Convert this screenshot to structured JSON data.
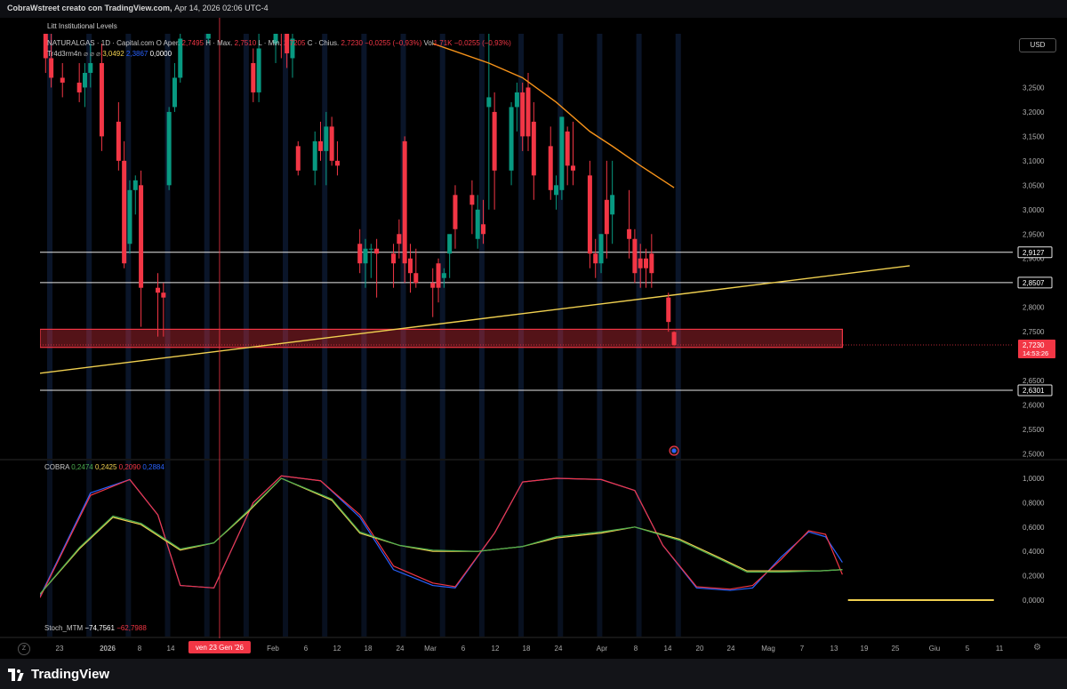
{
  "header": {
    "author": "CobraWstreet creato con TradingView.com,",
    "datetime": "Apr 14, 2026 02:06 UTC-4"
  },
  "indicator_title": "Litt Institutional Levels",
  "symbol_line": {
    "symbol": "NATURALGAS · 1D · Capital.com",
    "open_label": "O",
    "open_text": "Aper.",
    "open_value": "2,7495",
    "high_text": "H · Max.",
    "high_value": "2,7510",
    "low_text": "L · Min.",
    "low_value": "2,7205",
    "close_text": "C · Chius.",
    "close_value": "2,7230",
    "change": "−0,0255 (−0,93%)",
    "vol_label": "Vol",
    "vol_value": "1,71K"
  },
  "trader_line": {
    "name": "Tr4d3rm4n",
    "icons": "⌀ ⌀ ⌀",
    "v1": "3,0492",
    "v2": "2,3867",
    "v3": "0,0000"
  },
  "currency_button": "USD",
  "levels": [
    {
      "price": 2.9127,
      "label": "2,9127"
    },
    {
      "price": 2.8507,
      "label": "2,8507"
    },
    {
      "price": 2.6301,
      "label": "2,6301"
    }
  ],
  "last_price": {
    "label": "2,7230",
    "countdown": "14:53:26",
    "price": 2.723
  },
  "price_axis": {
    "labels": [
      "3,2500",
      "3,2000",
      "3,1500",
      "3,1000",
      "3,0500",
      "3,0000",
      "2,9500",
      "2,9000",
      "2,8000",
      "2,7500",
      "2,6500",
      "2,6000",
      "2,5500",
      "2,5000"
    ],
    "values": [
      3.25,
      3.2,
      3.15,
      3.1,
      3.05,
      3.0,
      2.95,
      2.9,
      2.8,
      2.75,
      2.65,
      2.6,
      2.55,
      2.5
    ]
  },
  "cobra": {
    "name": "COBRA",
    "values": [
      "0,2474",
      "0,2425",
      "0,2090",
      "0,2884"
    ],
    "colors": [
      "#4caf50",
      "#f0d050",
      "#f23645",
      "#2962ff"
    ],
    "axis_labels": [
      "1,0000",
      "0,8000",
      "0,6000",
      "0,4000",
      "0,2000",
      "0,0000"
    ],
    "axis_values": [
      1.0,
      0.8,
      0.6,
      0.4,
      0.2,
      0.0
    ]
  },
  "stoch": {
    "name": "Stoch_MTM",
    "v1": "−74,7561",
    "v2": "−62,7988"
  },
  "time_axis": {
    "labels": [
      "23",
      "2026",
      "8",
      "14",
      "Feb",
      "6",
      "12",
      "18",
      "24",
      "Mar",
      "6",
      "12",
      "18",
      "24",
      "Apr",
      "8",
      "14",
      "20",
      "24",
      "Mag",
      "7",
      "13",
      "19",
      "25",
      "Giu",
      "5",
      "11"
    ],
    "crosshair_label": "ven 23 Gen '26"
  },
  "colors": {
    "up": "#089981",
    "down": "#f23645",
    "ma": "#f7931a",
    "trend": "#f0d050",
    "zone": "#f23645",
    "blue_line": "#2962ff"
  },
  "chart_data": {
    "type": "candlestick",
    "title": "NATURALGAS · 1D · Capital.com",
    "ylim": [
      2.49,
      3.36
    ],
    "x_start": "2025-12-22",
    "x_end": "2026-06-14",
    "candles": [
      [
        "2025-12-23",
        3.46,
        3.58,
        3.28,
        3.31
      ],
      [
        "2025-12-24",
        3.31,
        3.36,
        3.25,
        3.27
      ],
      [
        "2025-12-26",
        3.27,
        3.3,
        3.23,
        3.26
      ],
      [
        "2025-12-29",
        3.26,
        3.3,
        3.22,
        3.24
      ],
      [
        "2025-12-30",
        3.25,
        3.3,
        3.21,
        3.28
      ],
      [
        "2025-12-31",
        3.28,
        3.34,
        3.25,
        3.3
      ],
      [
        "2026-01-02",
        3.3,
        3.34,
        3.12,
        3.15
      ],
      [
        "2026-01-05",
        3.18,
        3.22,
        3.08,
        3.1
      ],
      [
        "2026-01-06",
        3.1,
        3.14,
        2.88,
        2.89
      ],
      [
        "2026-01-07",
        2.93,
        3.06,
        2.91,
        3.04
      ],
      [
        "2026-01-08",
        3.04,
        3.07,
        2.99,
        3.06
      ],
      [
        "2026-01-09",
        3.05,
        3.08,
        2.76,
        2.84
      ],
      [
        "2026-01-12",
        2.84,
        2.87,
        2.74,
        2.83
      ],
      [
        "2026-01-13",
        2.83,
        2.85,
        2.74,
        2.82
      ],
      [
        "2026-01-14",
        3.05,
        3.21,
        3.04,
        3.2
      ],
      [
        "2026-01-15",
        3.21,
        3.3,
        3.2,
        3.27
      ],
      [
        "2026-01-16",
        3.27,
        3.36,
        3.26,
        3.35
      ],
      [
        "2026-01-21",
        3.35,
        3.6,
        3.34,
        3.55
      ],
      [
        "2026-01-26",
        3.5,
        3.75,
        3.45,
        3.6
      ],
      [
        "2026-01-29",
        3.3,
        3.33,
        3.22,
        3.24
      ],
      [
        "2026-01-30",
        3.24,
        3.36,
        3.22,
        3.33
      ],
      [
        "2026-02-02",
        3.34,
        3.4,
        3.3,
        3.38
      ],
      [
        "2026-02-03",
        3.37,
        3.4,
        3.31,
        3.36
      ],
      [
        "2026-02-04",
        3.36,
        3.4,
        3.29,
        3.32
      ],
      [
        "2026-02-05",
        3.31,
        3.36,
        3.27,
        3.35
      ],
      [
        "2026-02-06",
        3.13,
        3.14,
        3.07,
        3.08
      ],
      [
        "2026-02-09",
        3.08,
        3.16,
        3.05,
        3.14
      ],
      [
        "2026-02-10",
        3.14,
        3.18,
        3.1,
        3.12
      ],
      [
        "2026-02-11",
        3.12,
        3.2,
        3.05,
        3.17
      ],
      [
        "2026-02-12",
        3.17,
        3.19,
        3.09,
        3.1
      ],
      [
        "2026-02-13",
        3.1,
        3.14,
        3.07,
        3.09
      ],
      [
        "2026-02-17",
        2.93,
        2.96,
        2.87,
        2.89
      ],
      [
        "2026-02-18",
        2.89,
        2.94,
        2.84,
        2.92
      ],
      [
        "2026-02-19",
        2.92,
        2.93,
        2.86,
        2.92
      ],
      [
        "2026-02-20",
        2.92,
        2.94,
        2.82,
        2.91
      ],
      [
        "2026-02-23",
        2.91,
        2.93,
        2.84,
        2.89
      ],
      [
        "2026-02-24",
        2.95,
        2.98,
        2.9,
        2.93
      ],
      [
        "2026-02-25",
        3.14,
        3.15,
        2.85,
        2.89
      ],
      [
        "2026-02-26",
        2.9,
        2.93,
        2.83,
        2.87
      ],
      [
        "2026-02-27",
        2.87,
        2.92,
        2.84,
        2.85
      ],
      [
        "2026-03-02",
        2.85,
        2.88,
        2.78,
        2.84
      ],
      [
        "2026-03-03",
        2.89,
        2.9,
        2.81,
        2.84
      ],
      [
        "2026-03-04",
        2.86,
        2.88,
        2.84,
        2.87
      ],
      [
        "2026-03-05",
        2.91,
        2.94,
        2.86,
        2.95
      ],
      [
        "2026-03-06",
        3.03,
        3.05,
        2.92,
        2.96
      ],
      [
        "2026-03-09",
        3.03,
        3.06,
        2.95,
        3.01
      ],
      [
        "2026-03-10",
        2.94,
        3.03,
        2.92,
        3.0
      ],
      [
        "2026-03-11",
        2.97,
        3.02,
        2.93,
        2.95
      ],
      [
        "2026-03-12",
        3.21,
        3.4,
        3.0,
        3.23
      ],
      [
        "2026-03-13",
        3.2,
        3.24,
        3.0,
        3.08
      ],
      [
        "2026-03-16",
        3.08,
        3.22,
        3.05,
        3.21
      ],
      [
        "2026-03-17",
        3.21,
        3.26,
        3.16,
        3.24
      ],
      [
        "2026-03-18",
        3.24,
        3.26,
        3.12,
        3.15
      ],
      [
        "2026-03-19",
        3.25,
        3.28,
        3.12,
        3.15
      ],
      [
        "2026-03-20",
        3.18,
        3.22,
        3.02,
        3.07
      ],
      [
        "2026-03-23",
        3.13,
        3.17,
        3.02,
        3.04
      ],
      [
        "2026-03-24",
        3.03,
        3.07,
        3.0,
        3.05
      ],
      [
        "2026-03-25",
        3.04,
        3.19,
        3.02,
        3.19
      ],
      [
        "2026-03-26",
        3.16,
        3.17,
        3.05,
        3.09
      ],
      [
        "2026-03-27",
        3.09,
        3.18,
        3.05,
        3.08
      ],
      [
        "2026-03-30",
        3.07,
        3.1,
        2.88,
        2.91
      ],
      [
        "2026-03-31",
        2.91,
        2.94,
        2.86,
        2.89
      ],
      [
        "2026-04-01",
        2.89,
        2.95,
        2.87,
        2.95
      ],
      [
        "2026-04-02",
        3.02,
        3.1,
        2.9,
        2.95
      ],
      [
        "2026-04-03",
        2.99,
        3.1,
        2.93,
        3.03
      ],
      [
        "2026-04-06",
        2.96,
        3.04,
        2.9,
        2.94
      ],
      [
        "2026-04-07",
        2.94,
        2.96,
        2.85,
        2.87
      ],
      [
        "2026-04-08",
        2.9,
        2.93,
        2.84,
        2.88
      ],
      [
        "2026-04-09",
        2.9,
        2.92,
        2.84,
        2.88
      ],
      [
        "2026-04-10",
        2.91,
        2.95,
        2.84,
        2.87
      ],
      [
        "2026-04-13",
        2.82,
        2.83,
        2.75,
        2.77
      ],
      [
        "2026-04-14",
        2.7495,
        2.751,
        2.7205,
        2.723
      ]
    ],
    "moving_average": [
      [
        "2026-03-02",
        3.34
      ],
      [
        "2026-03-12",
        3.3
      ],
      [
        "2026-03-18",
        3.27
      ],
      [
        "2026-03-24",
        3.22
      ],
      [
        "2026-03-30",
        3.16
      ],
      [
        "2026-04-03",
        3.13
      ],
      [
        "2026-04-08",
        3.09
      ],
      [
        "2026-04-14",
        3.045
      ]
    ],
    "trendline": [
      [
        "2025-12-22",
        2.665
      ],
      [
        "2026-05-26",
        2.885
      ]
    ],
    "zone": {
      "x_start": "2025-12-22",
      "x_end": "2026-05-14",
      "y_low": 2.718,
      "y_high": 2.755
    },
    "horizontal_levels": [
      2.9127,
      2.8507,
      2.6301
    ],
    "cobra_series": [
      {
        "name": "blue",
        "color": "#2962ff",
        "points": [
          [
            "2025-12-22",
            0.03
          ],
          [
            "2025-12-31",
            0.88
          ],
          [
            "2026-01-07",
            0.99
          ],
          [
            "2026-01-12",
            0.7
          ],
          [
            "2026-01-16",
            0.12
          ],
          [
            "2026-01-22",
            0.1
          ],
          [
            "2026-01-29",
            0.8
          ],
          [
            "2026-02-03",
            1.02
          ],
          [
            "2026-02-10",
            0.98
          ],
          [
            "2026-02-17",
            0.68
          ],
          [
            "2026-02-23",
            0.25
          ],
          [
            "2026-03-02",
            0.12
          ],
          [
            "2026-03-06",
            0.1
          ],
          [
            "2026-03-13",
            0.55
          ],
          [
            "2026-03-18",
            0.97
          ],
          [
            "2026-03-24",
            1.0
          ],
          [
            "2026-04-01",
            0.99
          ],
          [
            "2026-04-07",
            0.9
          ],
          [
            "2026-04-12",
            0.45
          ],
          [
            "2026-04-18",
            0.1
          ],
          [
            "2026-04-24",
            0.08
          ],
          [
            "2026-04-28",
            0.1
          ],
          [
            "2026-05-03",
            0.35
          ],
          [
            "2026-05-08",
            0.56
          ],
          [
            "2026-05-11",
            0.52
          ],
          [
            "2026-05-14",
            0.31
          ]
        ]
      },
      {
        "name": "red",
        "color": "#f23645",
        "points": [
          [
            "2025-12-22",
            0.02
          ],
          [
            "2025-12-31",
            0.86
          ],
          [
            "2026-01-07",
            0.99
          ],
          [
            "2026-01-12",
            0.7
          ],
          [
            "2026-01-16",
            0.12
          ],
          [
            "2026-01-22",
            0.1
          ],
          [
            "2026-01-29",
            0.8
          ],
          [
            "2026-02-03",
            1.02
          ],
          [
            "2026-02-10",
            0.98
          ],
          [
            "2026-02-17",
            0.7
          ],
          [
            "2026-02-23",
            0.28
          ],
          [
            "2026-03-02",
            0.14
          ],
          [
            "2026-03-06",
            0.11
          ],
          [
            "2026-03-13",
            0.55
          ],
          [
            "2026-03-18",
            0.97
          ],
          [
            "2026-03-24",
            1.0
          ],
          [
            "2026-04-01",
            0.99
          ],
          [
            "2026-04-07",
            0.9
          ],
          [
            "2026-04-12",
            0.45
          ],
          [
            "2026-04-18",
            0.11
          ],
          [
            "2026-04-24",
            0.09
          ],
          [
            "2026-04-28",
            0.12
          ],
          [
            "2026-05-03",
            0.33
          ],
          [
            "2026-05-08",
            0.57
          ],
          [
            "2026-05-11",
            0.54
          ],
          [
            "2026-05-14",
            0.21
          ]
        ]
      },
      {
        "name": "yellow",
        "color": "#f0d050",
        "points": [
          [
            "2025-12-22",
            0.05
          ],
          [
            "2025-12-29",
            0.42
          ],
          [
            "2026-01-04",
            0.68
          ],
          [
            "2026-01-09",
            0.62
          ],
          [
            "2026-01-16",
            0.41
          ],
          [
            "2026-01-22",
            0.47
          ],
          [
            "2026-01-28",
            0.72
          ],
          [
            "2026-02-03",
            1.0
          ],
          [
            "2026-02-12",
            0.82
          ],
          [
            "2026-02-17",
            0.55
          ],
          [
            "2026-02-24",
            0.45
          ],
          [
            "2026-03-02",
            0.4
          ],
          [
            "2026-03-10",
            0.4
          ],
          [
            "2026-03-18",
            0.44
          ],
          [
            "2026-03-24",
            0.51
          ],
          [
            "2026-04-01",
            0.55
          ],
          [
            "2026-04-07",
            0.6
          ],
          [
            "2026-04-15",
            0.5
          ],
          [
            "2026-04-22",
            0.35
          ],
          [
            "2026-04-27",
            0.24
          ],
          [
            "2026-05-03",
            0.24
          ],
          [
            "2026-05-10",
            0.24
          ],
          [
            "2026-05-14",
            0.25
          ]
        ]
      },
      {
        "name": "green",
        "color": "#4caf50",
        "points": [
          [
            "2025-12-22",
            0.05
          ],
          [
            "2025-12-29",
            0.43
          ],
          [
            "2026-01-04",
            0.69
          ],
          [
            "2026-01-09",
            0.63
          ],
          [
            "2026-01-16",
            0.42
          ],
          [
            "2026-01-22",
            0.47
          ],
          [
            "2026-01-28",
            0.73
          ],
          [
            "2026-02-03",
            1.0
          ],
          [
            "2026-02-12",
            0.83
          ],
          [
            "2026-02-17",
            0.56
          ],
          [
            "2026-02-24",
            0.45
          ],
          [
            "2026-03-02",
            0.41
          ],
          [
            "2026-03-10",
            0.4
          ],
          [
            "2026-03-18",
            0.44
          ],
          [
            "2026-03-24",
            0.52
          ],
          [
            "2026-04-01",
            0.56
          ],
          [
            "2026-04-07",
            0.6
          ],
          [
            "2026-04-15",
            0.49
          ],
          [
            "2026-04-22",
            0.34
          ],
          [
            "2026-04-27",
            0.23
          ],
          [
            "2026-05-03",
            0.23
          ],
          [
            "2026-05-10",
            0.24
          ],
          [
            "2026-05-14",
            0.25
          ]
        ]
      }
    ],
    "stoch_line": [
      [
        "2026-05-15",
        0.0
      ],
      [
        "2026-06-10",
        0.0
      ]
    ]
  }
}
